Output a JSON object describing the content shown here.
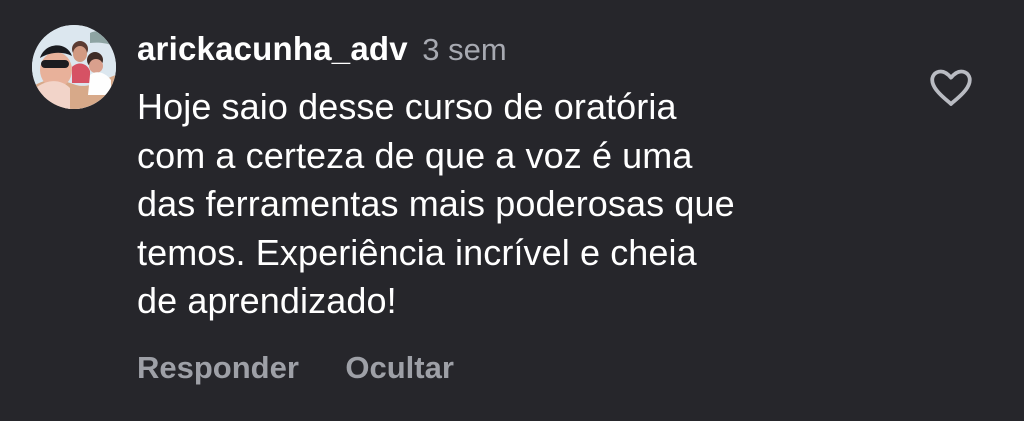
{
  "comment": {
    "username": "arickacunha_adv",
    "time": "3 sem",
    "text_lines": [
      "Hoje saio desse curso de oratória",
      "com a certeza de que a voz é uma",
      "das ferramentas mais poderosas que",
      "temos. Experiência incrível e cheia",
      "de aprendizado!"
    ]
  },
  "actions": {
    "reply_label": "Responder",
    "hide_label": "Ocultar"
  },
  "icons": {
    "like": "heart-icon"
  },
  "colors": {
    "background": "#26262b",
    "text": "#ffffff",
    "muted": "#a7a9b1"
  }
}
